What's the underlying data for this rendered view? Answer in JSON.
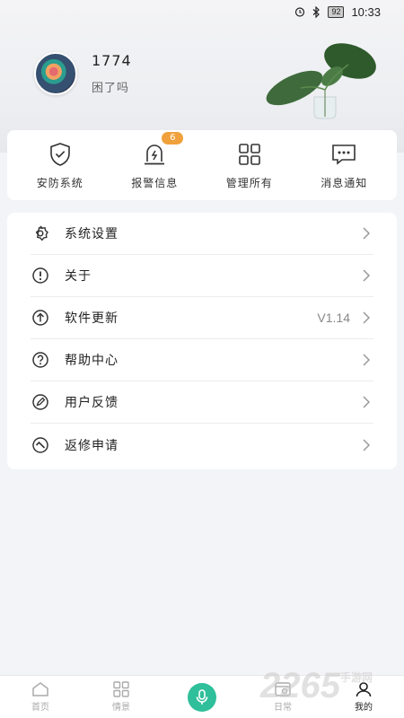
{
  "status_bar": {
    "battery": "92",
    "time": "10:33"
  },
  "profile": {
    "username": "1774",
    "signature": "困了吗"
  },
  "quick_actions": [
    {
      "label": "安防系统",
      "icon": "shield-check-icon"
    },
    {
      "label": "报警信息",
      "icon": "alarm-light-icon",
      "badge": "6"
    },
    {
      "label": "管理所有",
      "icon": "grid-icon"
    },
    {
      "label": "消息通知",
      "icon": "message-icon"
    }
  ],
  "menu": [
    {
      "label": "系统设置",
      "icon": "gear-icon",
      "value": ""
    },
    {
      "label": "关于",
      "icon": "info-icon",
      "value": ""
    },
    {
      "label": "软件更新",
      "icon": "upload-icon",
      "value": "V1.14"
    },
    {
      "label": "帮助中心",
      "icon": "help-icon",
      "value": ""
    },
    {
      "label": "用户反馈",
      "icon": "pen-icon",
      "value": ""
    },
    {
      "label": "返修申请",
      "icon": "wrench-icon",
      "value": ""
    }
  ],
  "bottom_nav": [
    {
      "label": "首页",
      "icon": "home-icon"
    },
    {
      "label": "情景",
      "icon": "scene-grid-icon"
    },
    {
      "label": "",
      "icon": "mic-icon"
    },
    {
      "label": "日常",
      "icon": "daily-icon"
    },
    {
      "label": "我的",
      "icon": "user-icon",
      "active": true
    }
  ],
  "watermark": {
    "number": "2265",
    "suffix": "手游网"
  },
  "colors": {
    "accent": "#2fbf9a",
    "badge": "#f0a13b"
  }
}
